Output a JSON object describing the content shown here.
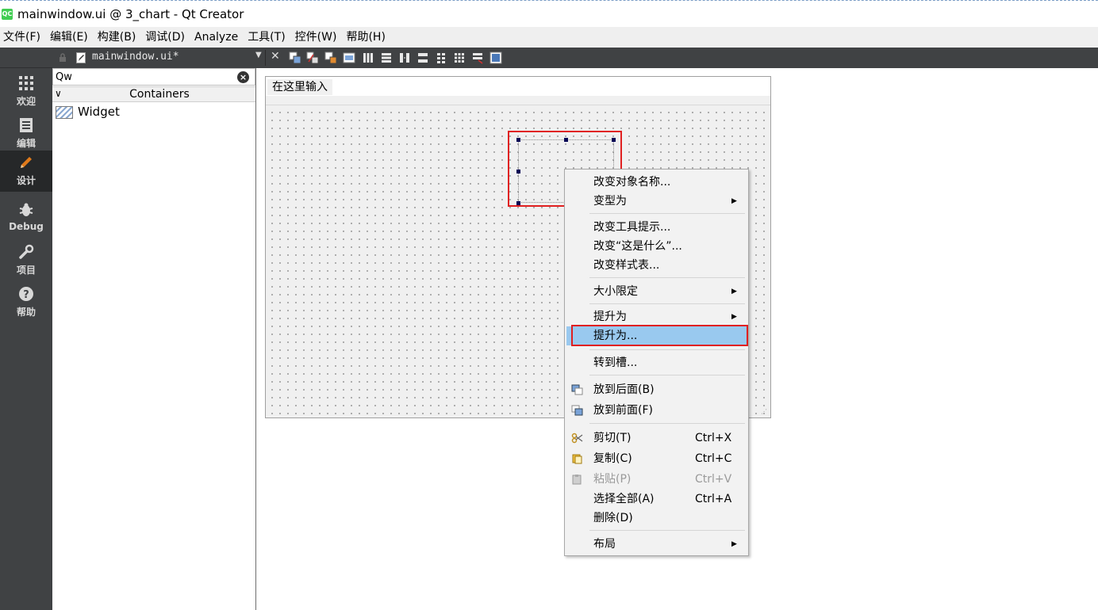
{
  "window": {
    "title": "mainwindow.ui @ 3_chart - Qt Creator",
    "app_icon": "QC"
  },
  "menubar": [
    "文件(F)",
    "编辑(E)",
    "构建(B)",
    "调试(D)",
    "Analyze",
    "工具(T)",
    "控件(W)",
    "帮助(H)"
  ],
  "modes": [
    {
      "label": "欢迎",
      "icon": "grid-icon"
    },
    {
      "label": "编辑",
      "icon": "document-icon"
    },
    {
      "label": "设计",
      "icon": "pencil-icon",
      "active": true
    },
    {
      "label": "Debug",
      "icon": "bug-icon"
    },
    {
      "label": "项目",
      "icon": "wrench-icon"
    },
    {
      "label": "帮助",
      "icon": "help-icon"
    }
  ],
  "editor_toolbar": {
    "file_name": "mainwindow.ui*",
    "close_glyph": "✕"
  },
  "widget_box": {
    "filter_value": "Qw",
    "category": "Containers",
    "items": [
      "Widget"
    ]
  },
  "form": {
    "type_here": "在这里输入"
  },
  "context_menu": {
    "items": [
      {
        "label": "改变对象名称...",
        "shortcut": "",
        "submenu": false
      },
      {
        "label": "变型为",
        "shortcut": "",
        "submenu": true
      },
      {
        "label": "改变工具提示...",
        "shortcut": "",
        "submenu": false
      },
      {
        "label": "改变“这是什么”...",
        "shortcut": "",
        "submenu": false
      },
      {
        "label": "改变样式表...",
        "shortcut": "",
        "submenu": false
      },
      {
        "label": "大小限定",
        "shortcut": "",
        "submenu": true
      },
      {
        "label": "提升为",
        "shortcut": "",
        "submenu": true
      },
      {
        "label": "提升为...",
        "shortcut": "",
        "submenu": false,
        "highlighted": true
      },
      {
        "label": "转到槽...",
        "shortcut": "",
        "submenu": false
      },
      {
        "label": "放到后面(B)",
        "shortcut": "",
        "submenu": false,
        "icon": "send-back-icon"
      },
      {
        "label": "放到前面(F)",
        "shortcut": "",
        "submenu": false,
        "icon": "bring-front-icon"
      },
      {
        "label": "剪切(T)",
        "shortcut": "Ctrl+X",
        "submenu": false,
        "icon": "scissors-icon"
      },
      {
        "label": "复制(C)",
        "shortcut": "Ctrl+C",
        "submenu": false,
        "icon": "copy-icon"
      },
      {
        "label": "粘贴(P)",
        "shortcut": "Ctrl+V",
        "submenu": false,
        "icon": "paste-icon",
        "disabled": true
      },
      {
        "label": "选择全部(A)",
        "shortcut": "Ctrl+A",
        "submenu": false
      },
      {
        "label": "删除(D)",
        "shortcut": "",
        "submenu": false
      },
      {
        "label": "布局",
        "shortcut": "",
        "submenu": true
      }
    ]
  },
  "colors": {
    "highlight": "#99c9ef",
    "annotation_red": "#e02020",
    "sidebar": "#404244"
  }
}
